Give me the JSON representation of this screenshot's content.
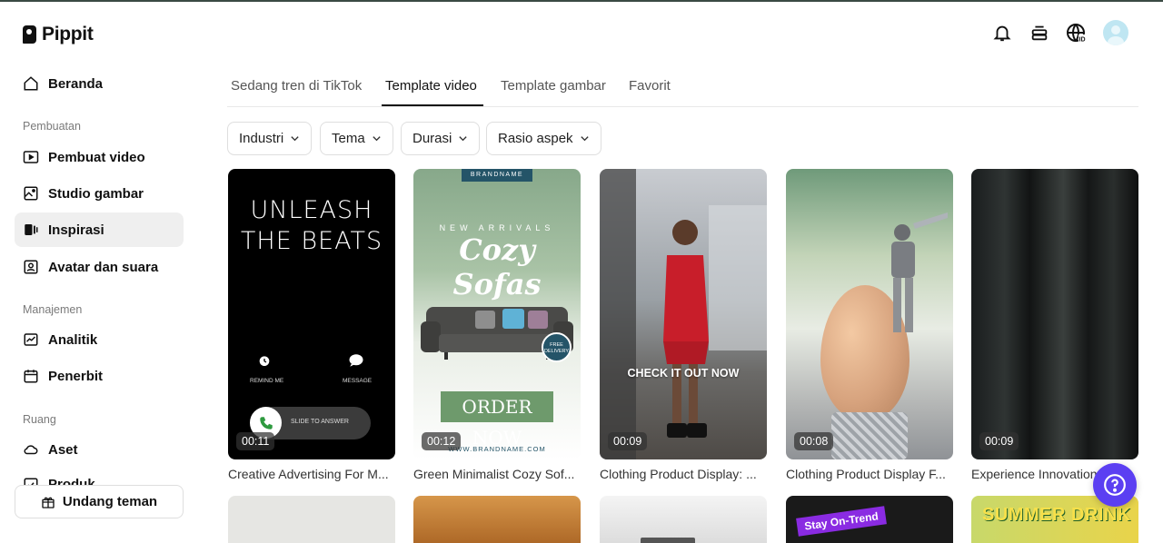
{
  "app": {
    "logo_text": "Pippit"
  },
  "sidebar": {
    "home": "Beranda",
    "sections": {
      "creation": "Pembuatan",
      "management": "Manajemen",
      "space": "Ruang"
    },
    "items": {
      "video_maker": "Pembuat video",
      "image_studio": "Studio gambar",
      "inspiration": "Inspirasi",
      "avatar_voice": "Avatar dan suara",
      "analytics": "Analitik",
      "publisher": "Penerbit",
      "assets": "Aset",
      "products": "Produk"
    },
    "invite_label": "Undang teman"
  },
  "top_icons": [
    "bell-icon",
    "stack-icon",
    "globe-id-icon",
    "avatar"
  ],
  "tabs": [
    {
      "label": "Sedang tren di TikTok"
    },
    {
      "label": "Template video"
    },
    {
      "label": "Template gambar"
    },
    {
      "label": "Favorit"
    }
  ],
  "active_tab": "Template video",
  "filters": [
    {
      "label": "Industri"
    },
    {
      "label": "Tema"
    },
    {
      "label": "Durasi"
    },
    {
      "label": "Rasio aspek"
    }
  ],
  "cards": [
    {
      "title": "Creative Advertising For M...",
      "duration": "00:11",
      "overlay": {
        "line1": "UNLEASH",
        "line2": "THE BEATS",
        "remind": "REMIND ME",
        "message": "MESSAGE",
        "slide": "SLIDE TO ANSWER"
      }
    },
    {
      "title": "Green Minimalist Cozy Sof...",
      "duration": "00:12",
      "overlay": {
        "brand_top": "BRANDNAME",
        "new_arrivals": "NEW ARRIVALS",
        "headline": "Cozy Sofas",
        "badge": "FREE DELIVERY",
        "cta": "ORDER NOW",
        "url": "WWW.BRANDNAME.COM"
      }
    },
    {
      "title": "Clothing Product Display: ...",
      "duration": "00:09",
      "overlay": {
        "cta": "CHECK IT OUT NOW"
      }
    },
    {
      "title": "Clothing Product Display F...",
      "duration": "00:08"
    },
    {
      "title": "Experience Innovation",
      "duration": "00:09"
    }
  ],
  "row2": {
    "stay_on_trend": "Stay On-Trend",
    "summer_drink": "SUMMER DRINK"
  },
  "colors": {
    "accent": "#5b3ff2",
    "active_bg": "#efefef"
  }
}
